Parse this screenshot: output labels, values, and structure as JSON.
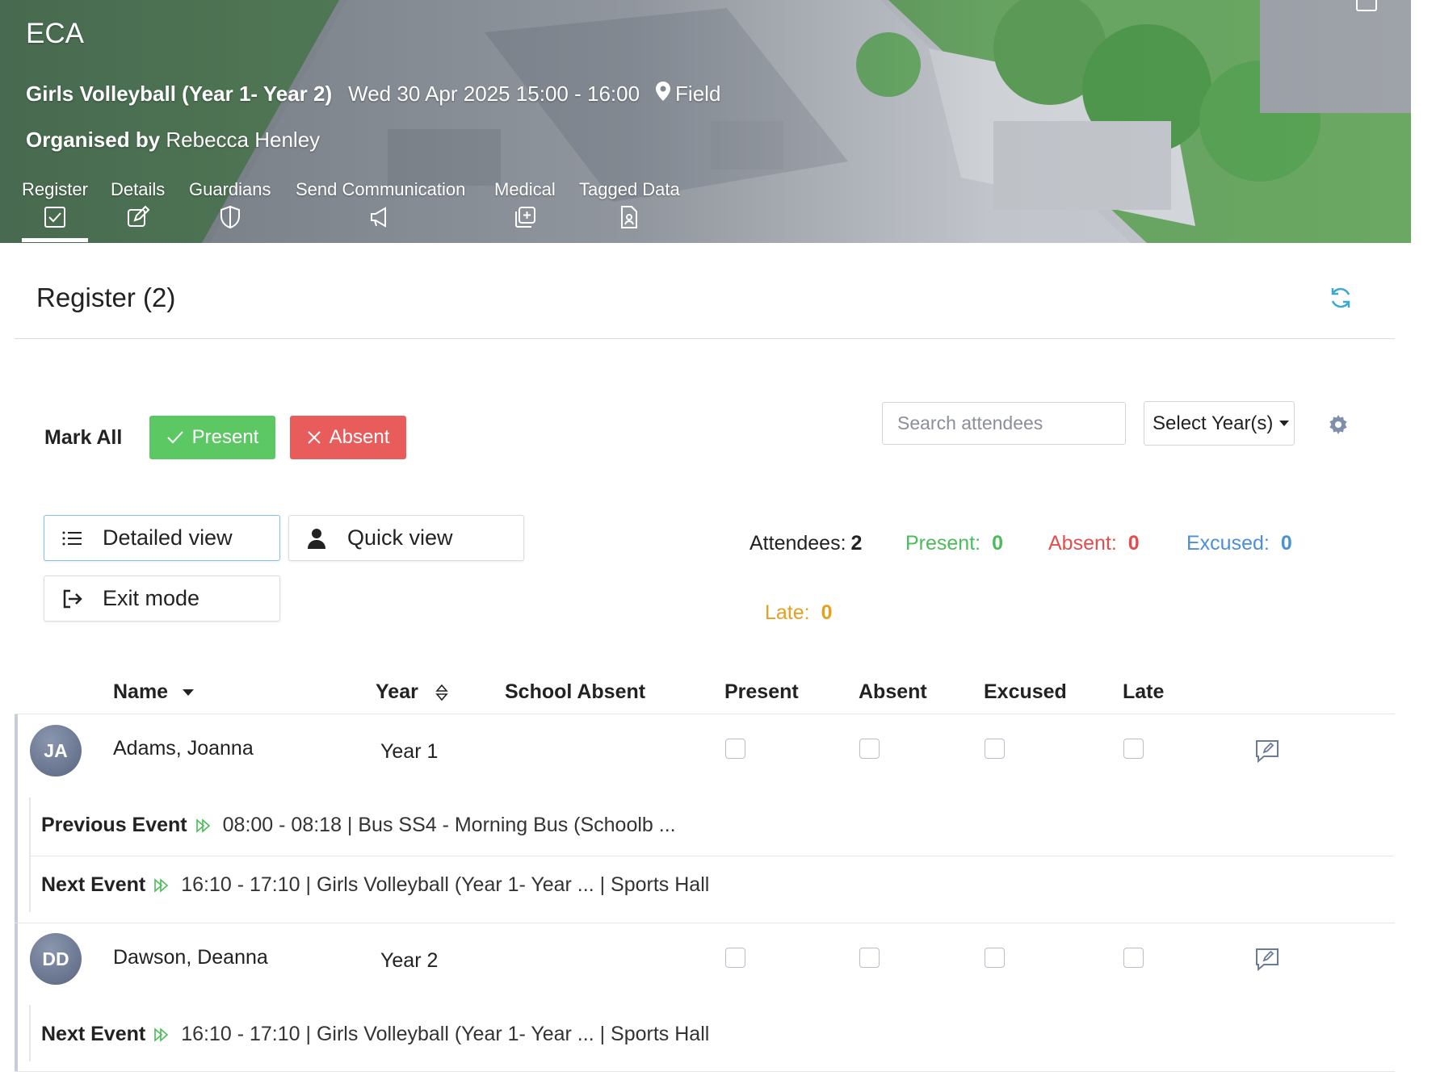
{
  "header": {
    "app_title": "ECA",
    "event_title": "Girls Volleyball (Year 1- Year 2)",
    "event_datetime": "Wed 30 Apr 2025 15:00 - 16:00",
    "location": "Field",
    "organised_label": "Organised by",
    "organiser": "Rebecca Henley",
    "tabs": [
      {
        "label": "Register",
        "icon": "checkbox-icon",
        "active": true
      },
      {
        "label": "Details",
        "icon": "edit-icon"
      },
      {
        "label": "Guardians",
        "icon": "shield-icon"
      },
      {
        "label": "Send Communication",
        "icon": "megaphone-icon"
      },
      {
        "label": "Medical",
        "icon": "medical-icon"
      },
      {
        "label": "Tagged Data",
        "icon": "tagged-doc-icon"
      }
    ]
  },
  "register": {
    "title": "Register (2)",
    "mark_all_label": "Mark All",
    "present_btn": "Present",
    "absent_btn": "Absent",
    "search_placeholder": "Search attendees",
    "year_select": "Select Year(s)",
    "views": {
      "detailed": "Detailed view",
      "quick": "Quick view",
      "exit": "Exit mode"
    },
    "stats": {
      "attendees_label": "Attendees:",
      "attendees": "2",
      "present_label": "Present:",
      "present": "0",
      "absent_label": "Absent:",
      "absent": "0",
      "excused_label": "Excused:",
      "excused": "0",
      "late_label": "Late:",
      "late": "0"
    },
    "columns": [
      "Name",
      "Year",
      "School Absent",
      "Present",
      "Absent",
      "Excused",
      "Late"
    ],
    "rows": [
      {
        "initials": "JA",
        "name": "Adams, Joanna",
        "year": "Year 1",
        "previous_label": "Previous Event",
        "previous": "08:00 - 08:18 | Bus SS4 - Morning Bus (Schoolb ...",
        "next_label": "Next Event",
        "next": "16:10 - 17:10 | Girls Volleyball (Year 1- Year ... | Sports Hall"
      },
      {
        "initials": "DD",
        "name": "Dawson, Deanna",
        "year": "Year 2",
        "next_label": "Next Event",
        "next": "16:10 - 17:10 | Girls Volleyball (Year 1- Year ... | Sports Hall"
      }
    ]
  },
  "colors": {
    "present": "#5cc864",
    "absent": "#e85c5c",
    "excused": "#4a8fd8",
    "late": "#e6a01f",
    "accent": "#3aa9d6"
  }
}
